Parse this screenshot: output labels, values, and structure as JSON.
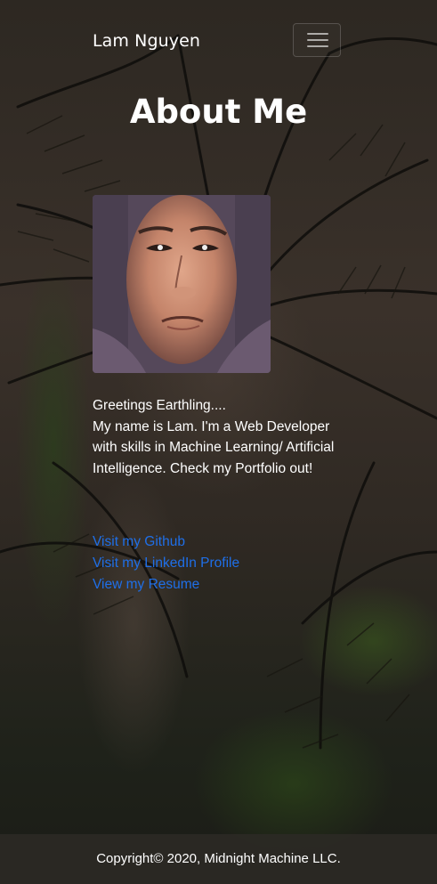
{
  "navbar": {
    "brand": "Lam Nguyen",
    "toggler_icon": "hamburger-menu-icon"
  },
  "main": {
    "heading": "About Me",
    "bio": {
      "greeting": "Greetings Earthling....",
      "text": "My name is Lam. I'm a Web Developer with skills in Machine Learning/ Artificial Intelligence. Check my Portfolio out!"
    },
    "links": [
      {
        "label": "Visit my Github"
      },
      {
        "label": "Visit my LinkedIn Profile"
      },
      {
        "label": "View my Resume"
      }
    ]
  },
  "footer": {
    "copyright": "Copyright© 2020, Midnight Machine LLC."
  },
  "colors": {
    "link": "#1f6fe8",
    "text": "#ffffff",
    "background": "#2a2520"
  }
}
